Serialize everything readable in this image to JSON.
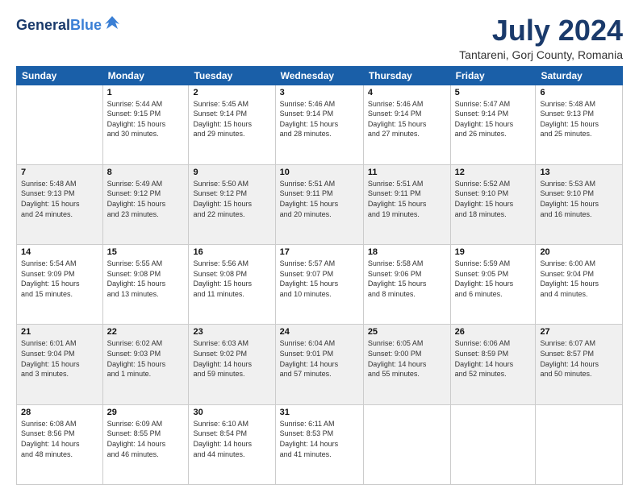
{
  "header": {
    "logo_general": "General",
    "logo_blue": "Blue",
    "month": "July 2024",
    "location": "Tantareni, Gorj County, Romania"
  },
  "days_of_week": [
    "Sunday",
    "Monday",
    "Tuesday",
    "Wednesday",
    "Thursday",
    "Friday",
    "Saturday"
  ],
  "weeks": [
    [
      {
        "day": "",
        "info": ""
      },
      {
        "day": "1",
        "info": "Sunrise: 5:44 AM\nSunset: 9:15 PM\nDaylight: 15 hours\nand 30 minutes."
      },
      {
        "day": "2",
        "info": "Sunrise: 5:45 AM\nSunset: 9:14 PM\nDaylight: 15 hours\nand 29 minutes."
      },
      {
        "day": "3",
        "info": "Sunrise: 5:46 AM\nSunset: 9:14 PM\nDaylight: 15 hours\nand 28 minutes."
      },
      {
        "day": "4",
        "info": "Sunrise: 5:46 AM\nSunset: 9:14 PM\nDaylight: 15 hours\nand 27 minutes."
      },
      {
        "day": "5",
        "info": "Sunrise: 5:47 AM\nSunset: 9:14 PM\nDaylight: 15 hours\nand 26 minutes."
      },
      {
        "day": "6",
        "info": "Sunrise: 5:48 AM\nSunset: 9:13 PM\nDaylight: 15 hours\nand 25 minutes."
      }
    ],
    [
      {
        "day": "7",
        "info": "Sunrise: 5:48 AM\nSunset: 9:13 PM\nDaylight: 15 hours\nand 24 minutes."
      },
      {
        "day": "8",
        "info": "Sunrise: 5:49 AM\nSunset: 9:12 PM\nDaylight: 15 hours\nand 23 minutes."
      },
      {
        "day": "9",
        "info": "Sunrise: 5:50 AM\nSunset: 9:12 PM\nDaylight: 15 hours\nand 22 minutes."
      },
      {
        "day": "10",
        "info": "Sunrise: 5:51 AM\nSunset: 9:11 PM\nDaylight: 15 hours\nand 20 minutes."
      },
      {
        "day": "11",
        "info": "Sunrise: 5:51 AM\nSunset: 9:11 PM\nDaylight: 15 hours\nand 19 minutes."
      },
      {
        "day": "12",
        "info": "Sunrise: 5:52 AM\nSunset: 9:10 PM\nDaylight: 15 hours\nand 18 minutes."
      },
      {
        "day": "13",
        "info": "Sunrise: 5:53 AM\nSunset: 9:10 PM\nDaylight: 15 hours\nand 16 minutes."
      }
    ],
    [
      {
        "day": "14",
        "info": "Sunrise: 5:54 AM\nSunset: 9:09 PM\nDaylight: 15 hours\nand 15 minutes."
      },
      {
        "day": "15",
        "info": "Sunrise: 5:55 AM\nSunset: 9:08 PM\nDaylight: 15 hours\nand 13 minutes."
      },
      {
        "day": "16",
        "info": "Sunrise: 5:56 AM\nSunset: 9:08 PM\nDaylight: 15 hours\nand 11 minutes."
      },
      {
        "day": "17",
        "info": "Sunrise: 5:57 AM\nSunset: 9:07 PM\nDaylight: 15 hours\nand 10 minutes."
      },
      {
        "day": "18",
        "info": "Sunrise: 5:58 AM\nSunset: 9:06 PM\nDaylight: 15 hours\nand 8 minutes."
      },
      {
        "day": "19",
        "info": "Sunrise: 5:59 AM\nSunset: 9:05 PM\nDaylight: 15 hours\nand 6 minutes."
      },
      {
        "day": "20",
        "info": "Sunrise: 6:00 AM\nSunset: 9:04 PM\nDaylight: 15 hours\nand 4 minutes."
      }
    ],
    [
      {
        "day": "21",
        "info": "Sunrise: 6:01 AM\nSunset: 9:04 PM\nDaylight: 15 hours\nand 3 minutes."
      },
      {
        "day": "22",
        "info": "Sunrise: 6:02 AM\nSunset: 9:03 PM\nDaylight: 15 hours\nand 1 minute."
      },
      {
        "day": "23",
        "info": "Sunrise: 6:03 AM\nSunset: 9:02 PM\nDaylight: 14 hours\nand 59 minutes."
      },
      {
        "day": "24",
        "info": "Sunrise: 6:04 AM\nSunset: 9:01 PM\nDaylight: 14 hours\nand 57 minutes."
      },
      {
        "day": "25",
        "info": "Sunrise: 6:05 AM\nSunset: 9:00 PM\nDaylight: 14 hours\nand 55 minutes."
      },
      {
        "day": "26",
        "info": "Sunrise: 6:06 AM\nSunset: 8:59 PM\nDaylight: 14 hours\nand 52 minutes."
      },
      {
        "day": "27",
        "info": "Sunrise: 6:07 AM\nSunset: 8:57 PM\nDaylight: 14 hours\nand 50 minutes."
      }
    ],
    [
      {
        "day": "28",
        "info": "Sunrise: 6:08 AM\nSunset: 8:56 PM\nDaylight: 14 hours\nand 48 minutes."
      },
      {
        "day": "29",
        "info": "Sunrise: 6:09 AM\nSunset: 8:55 PM\nDaylight: 14 hours\nand 46 minutes."
      },
      {
        "day": "30",
        "info": "Sunrise: 6:10 AM\nSunset: 8:54 PM\nDaylight: 14 hours\nand 44 minutes."
      },
      {
        "day": "31",
        "info": "Sunrise: 6:11 AM\nSunset: 8:53 PM\nDaylight: 14 hours\nand 41 minutes."
      },
      {
        "day": "",
        "info": ""
      },
      {
        "day": "",
        "info": ""
      },
      {
        "day": "",
        "info": ""
      }
    ]
  ]
}
